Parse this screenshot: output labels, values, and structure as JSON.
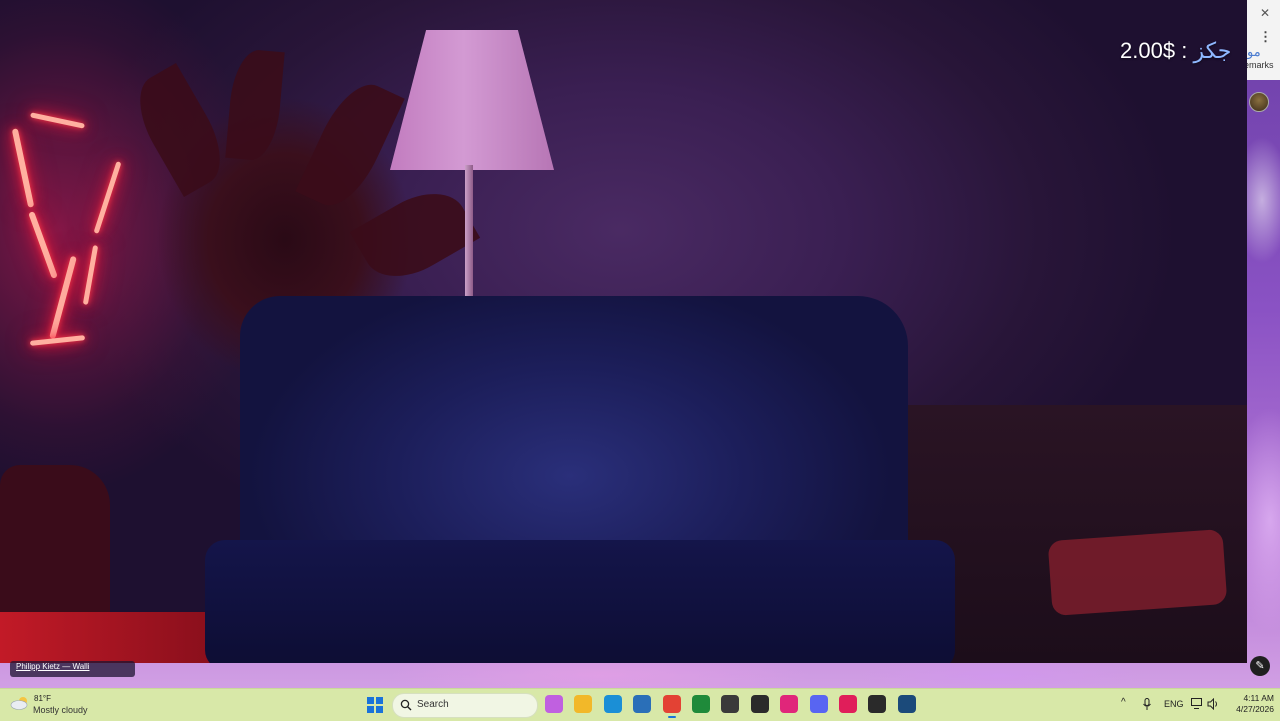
{
  "overlay": {
    "arabic_label": "جكز",
    "separator": ":",
    "amount": "2.00$"
  },
  "browser_strip": {
    "close_glyph": "✕",
    "menu_glyph": "⋮",
    "text_top": "مو",
    "bookmarks_partial": "emarks"
  },
  "wallpaper_credit": "Philipp Kietz — Walli",
  "taskbar": {
    "weather": {
      "temp": "81°F",
      "condition": "Mostly cloudy"
    },
    "search_placeholder": "Search",
    "pinned": [
      {
        "name": "copilot-icon",
        "color": "#c060e0"
      },
      {
        "name": "file-explorer-icon",
        "color": "#f2b829"
      },
      {
        "name": "edge-icon",
        "color": "#1b8fd6"
      },
      {
        "name": "store-icon",
        "color": "#2a6fb8"
      },
      {
        "name": "chrome-icon",
        "color": "#e34234",
        "active": true
      },
      {
        "name": "xbox-icon",
        "color": "#1f8a3a"
      },
      {
        "name": "gamepad-icon",
        "color": "#3a3a3a"
      },
      {
        "name": "usb-drive-icon",
        "color": "#2b2b2b"
      },
      {
        "name": "iptv-icon",
        "color": "#e0267a"
      },
      {
        "name": "discord-icon",
        "color": "#5865f2"
      },
      {
        "name": "tiktok-icon",
        "color": "#e01e5a"
      },
      {
        "name": "obs-icon",
        "color": "#2a2a2a"
      },
      {
        "name": "steam-icon",
        "color": "#1b4a7a"
      }
    ],
    "tray": {
      "language": "ENG"
    },
    "clock": {
      "time": "4:11 AM",
      "date": "4/27/2026"
    }
  },
  "colors": {
    "accent": "#1a73d9",
    "taskbar_bg": "#d8e8a8"
  }
}
